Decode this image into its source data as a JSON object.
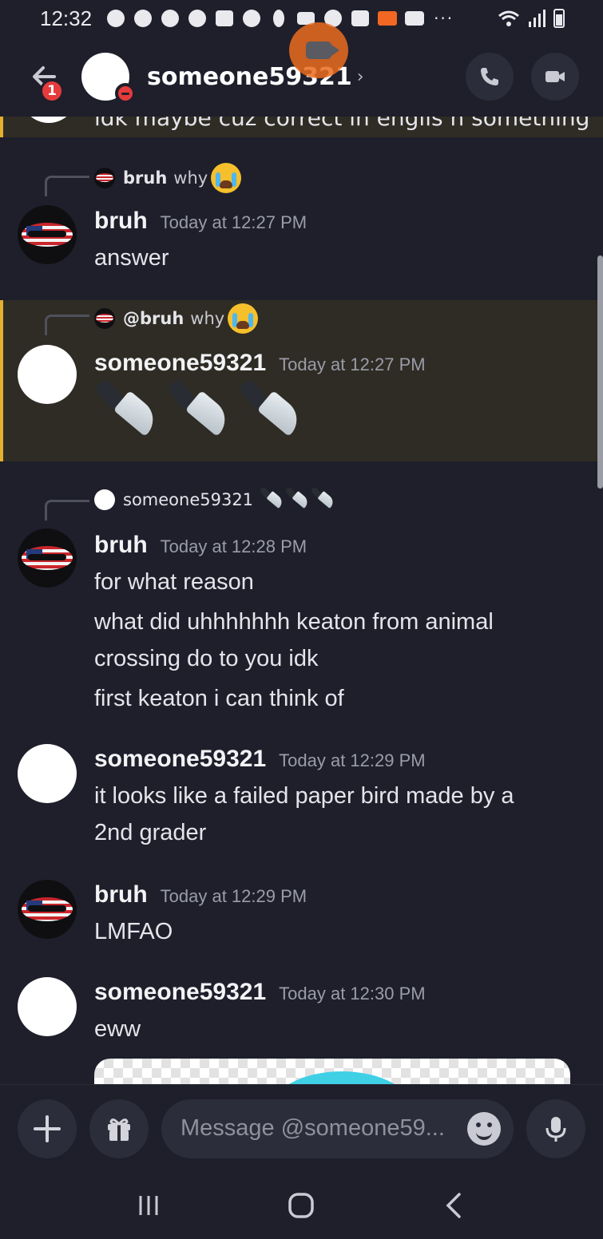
{
  "status_bar": {
    "time": "12:32",
    "more": "···"
  },
  "header": {
    "badge_count": "1",
    "username": "someone59321",
    "chevron": "›"
  },
  "chat": {
    "cut_message": "idk maybe cuz correct in englis n something",
    "messages": [
      {
        "reply_to": {
          "name": "bruh",
          "text": "why"
        },
        "author": "bruh",
        "time": "Today at 12:27 PM",
        "lines": [
          "answer"
        ]
      },
      {
        "reply_to": {
          "name": "@bruh",
          "text": "why"
        },
        "author": "someone59321",
        "time": "Today at 12:27 PM",
        "lines": []
      },
      {
        "reply_to": {
          "name": "someone59321",
          "text": ""
        },
        "author": "bruh",
        "time": "Today at 12:28 PM",
        "lines": [
          "for what reason",
          "what did uhhhhhhh keaton from animal crossing do to you idk",
          "first keaton i can think of"
        ]
      },
      {
        "author": "someone59321",
        "time": "Today at 12:29 PM",
        "lines": [
          "it looks like a failed paper bird made by a 2nd grader"
        ]
      },
      {
        "author": "bruh",
        "time": "Today at 12:29 PM",
        "lines": [
          "LMFAO"
        ]
      },
      {
        "author": "someone59321",
        "time": "Today at 12:30 PM",
        "lines": [
          "eww"
        ]
      }
    ]
  },
  "input": {
    "placeholder": "Message @someone59..."
  },
  "colors": {
    "background": "#1e1f2b",
    "highlight": "#2f2c25",
    "mention_bar": "#e4b02e",
    "badge": "#e53b3b"
  }
}
